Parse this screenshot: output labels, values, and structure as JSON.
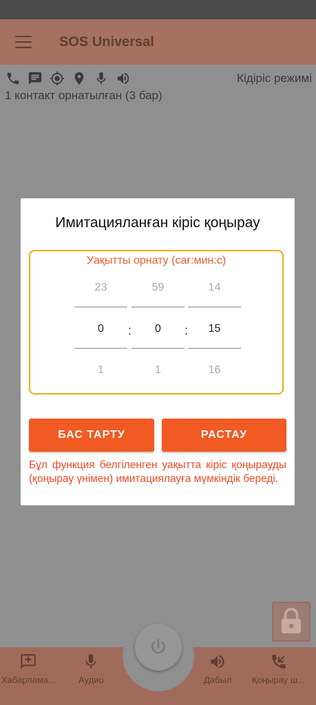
{
  "app": {
    "title": "SOS Universal"
  },
  "toolbar": {
    "icons": [
      "phone-icon",
      "message-icon",
      "gps-target-icon",
      "location-pin-icon",
      "microphone-icon",
      "speaker-icon"
    ],
    "mode_text": "Кідіріс режимі"
  },
  "status": {
    "contacts_text": "1 контакт орнатылған (3 бар)"
  },
  "dialog": {
    "title": "Имитацияланған кіріс қоңырау",
    "picker_label": "Уақытты орнату (сағ:мин:с)",
    "separator": ":",
    "hours": {
      "prev": "23",
      "current": "0",
      "next": "1"
    },
    "minutes": {
      "prev": "59",
      "current": "0",
      "next": "1"
    },
    "seconds": {
      "prev": "14",
      "current": "15",
      "next": "16"
    },
    "cancel_label": "БАС ТАРТУ",
    "confirm_label": "РАСТАУ",
    "info_text": "Бұл функция белгіленген уақытта кіріс қоңырауды (қоңырау үнімен) имитациялауға мүмкіндік береді."
  },
  "bottom_nav": {
    "messages_label": "Хабарлама...",
    "audio_label": "Аудио",
    "alarm_label": "Дабыл",
    "call_label": "Қоңырау ш..."
  },
  "colors": {
    "accent": "#f15a22",
    "picker_border": "#f0a818",
    "appbar": "#a57161"
  }
}
